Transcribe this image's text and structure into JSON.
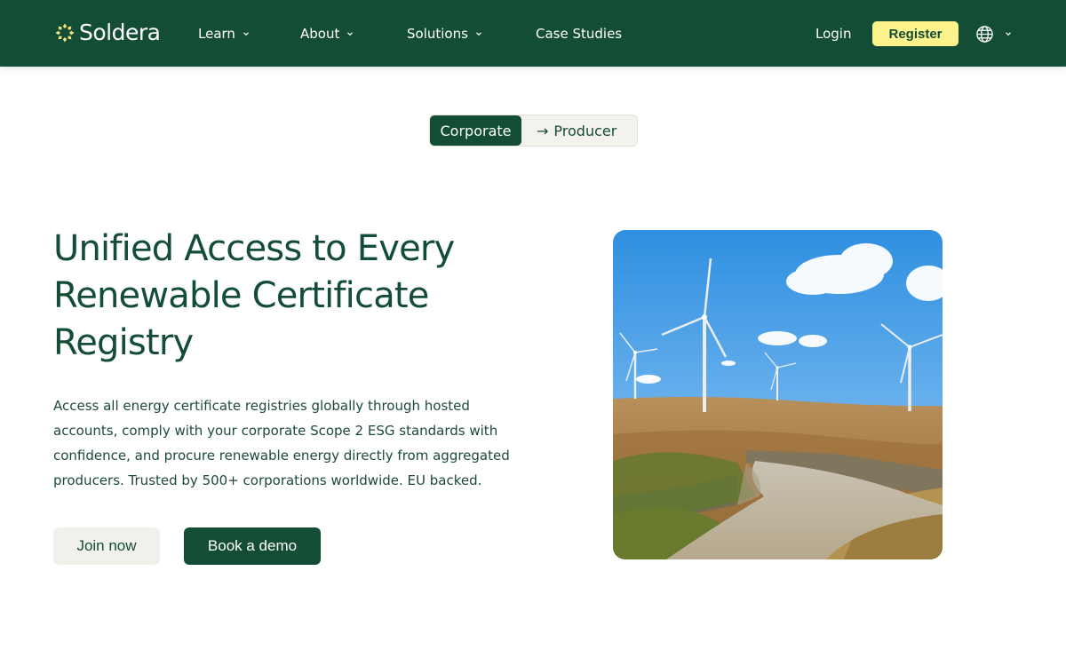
{
  "brand": {
    "name": "Soldera"
  },
  "nav": {
    "items": [
      {
        "label": "Learn",
        "has_dropdown": true
      },
      {
        "label": "About",
        "has_dropdown": true
      },
      {
        "label": "Solutions",
        "has_dropdown": true
      },
      {
        "label": "Case Studies",
        "has_dropdown": false
      }
    ],
    "login_label": "Login",
    "register_label": "Register",
    "language_icon": "globe-icon"
  },
  "audience_toggle": {
    "options": [
      {
        "label": "Corporate",
        "selected": true
      },
      {
        "label": "Producer",
        "selected": false
      }
    ],
    "arrow": "→"
  },
  "hero": {
    "title": "Unified Access to Every Renewable Certificate Registry",
    "description": "Access all energy certificate registries globally through hosted accounts, comply with your corporate Scope 2 ESG standards with confidence, and procure renewable energy directly from aggregated producers. Trusted by  500+ corporations worldwide. EU backed.",
    "primary_button": "Join now",
    "secondary_button": "Book a demo",
    "image_subject": "wind-turbines-moorland-photo"
  },
  "colors": {
    "brand_dark_green": "#134d36",
    "accent_yellow": "#fdf38d",
    "light_beige": "#f1f0ea",
    "logo_yellow": "#f5e57a"
  }
}
